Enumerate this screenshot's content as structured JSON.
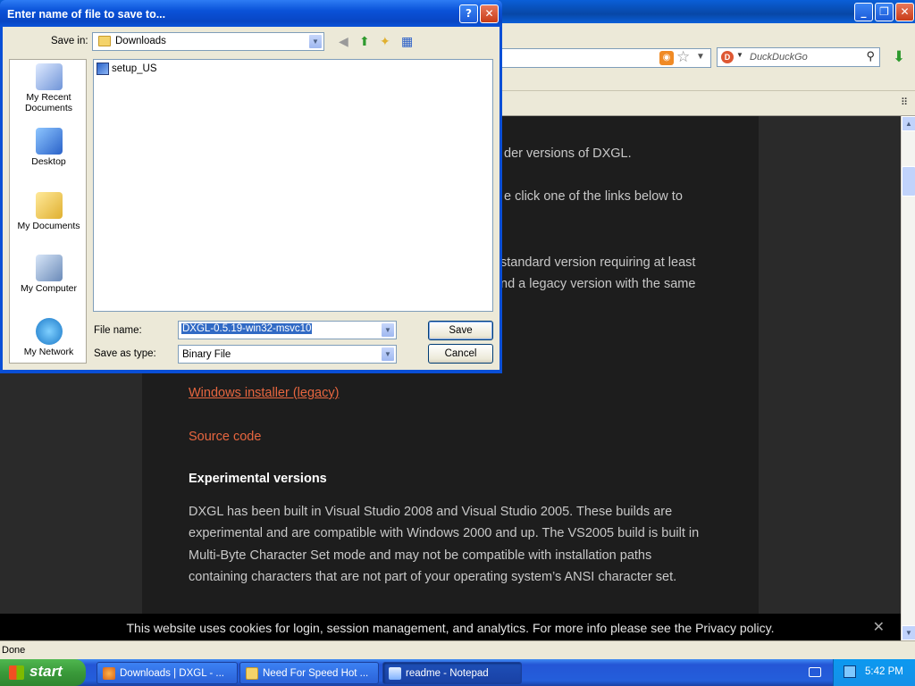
{
  "dialog": {
    "title": "Enter name of file to save to...",
    "save_in_label": "Save in:",
    "save_in_value": "Downloads",
    "places": [
      "My Recent Documents",
      "Desktop",
      "My Documents",
      "My Computer",
      "My Network"
    ],
    "files": [
      "setup_US"
    ],
    "file_name_label": "File name:",
    "file_name_value": "DXGL-0.5.19-win32-msvc10",
    "save_as_type_label": "Save as type:",
    "save_as_type_value": "Binary File",
    "save_label": "Save",
    "cancel_label": "Cancel",
    "help_glyph": "?",
    "close_glyph": "✕"
  },
  "browser": {
    "search_placeholder": "DuckDuckGo",
    "status": "Done"
  },
  "page": {
    "fragment1": "der versions of DXGL.",
    "fragment2": "e click one of the links below to",
    "fragment3": "standard version requiring at least",
    "fragment4": "nd a legacy version with the same",
    "link_installer_legacy": "Windows installer (legacy)",
    "link_source": "Source code",
    "exp_heading": "Experimental versions",
    "exp_lines": [
      "DXGL has been built in Visual Studio 2008 and Visual Studio 2005.  These builds are",
      "experimental and are compatible with Windows 2000 and up.  The VS2005 build is built in",
      "Multi-Byte Character Set mode and may not be compatible with installation paths",
      "containing characters that are not part of your operating system’s ANSI character set."
    ],
    "cookie_text": "This website uses cookies for login, session management, and analytics. For more info please see the ",
    "cookie_link": "Privacy policy",
    "cookie_end": "."
  },
  "taskbar": {
    "start": "start",
    "tasks": [
      "Downloads | DXGL - ...",
      "Need For Speed Hot ...",
      "readme - Notepad"
    ],
    "clock": "5:42 PM"
  },
  "colors": {
    "link": "#e7663f",
    "xp_blue": "#0a4fd6",
    "start_green": "#3a9a3a"
  }
}
